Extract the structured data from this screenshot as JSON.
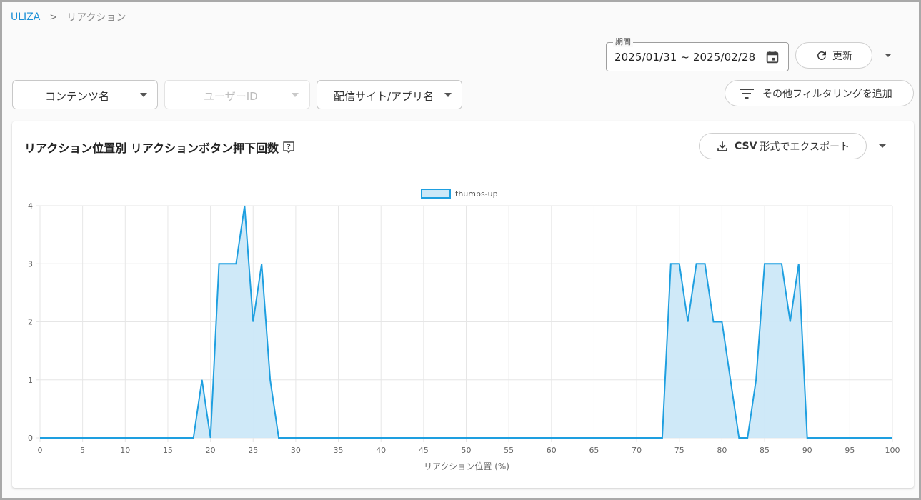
{
  "breadcrumb": {
    "root": "ULIZA",
    "current": "リアクション"
  },
  "period": {
    "legend": "期間",
    "value": "2025/01/31 ~ 2025/02/28"
  },
  "toolbar": {
    "refresh_label": "更新"
  },
  "filters": {
    "content_name": "コンテンツ名",
    "user_id": "ユーザーID",
    "site_app": "配信サイト/アプリ名",
    "more_filters": "その他フィルタリングを追加"
  },
  "card": {
    "title": "リアクション位置別 リアクションボタン押下回数",
    "export_prefix": "CSV",
    "export_suffix": "形式でエクスポート"
  },
  "colors": {
    "accent": "#1a8fd6",
    "series_line": "#1e9fe0",
    "series_fill": "#cce8f8"
  },
  "icons": [
    "calendar-icon",
    "refresh-icon",
    "chevron-down-icon",
    "filter-icon",
    "help-icon",
    "download-icon"
  ],
  "chart_data": {
    "type": "area",
    "xlabel": "リアクション位置 (%)",
    "ylabel": "",
    "xlim": [
      0,
      100
    ],
    "ylim": [
      0,
      4
    ],
    "x_ticks": [
      0,
      5,
      10,
      15,
      20,
      25,
      30,
      35,
      40,
      45,
      50,
      55,
      60,
      65,
      70,
      75,
      80,
      85,
      90,
      95,
      100
    ],
    "y_ticks": [
      0,
      1,
      2,
      3,
      4
    ],
    "grid": true,
    "legend": "top-center",
    "series": [
      {
        "name": "thumbs-up",
        "x": [
          0,
          1,
          2,
          3,
          4,
          5,
          6,
          7,
          8,
          9,
          10,
          11,
          12,
          13,
          14,
          15,
          16,
          17,
          18,
          19,
          20,
          21,
          22,
          23,
          24,
          25,
          26,
          27,
          28,
          29,
          30,
          31,
          32,
          33,
          34,
          35,
          36,
          37,
          38,
          39,
          40,
          41,
          42,
          43,
          44,
          45,
          46,
          47,
          48,
          49,
          50,
          51,
          52,
          53,
          54,
          55,
          56,
          57,
          58,
          59,
          60,
          61,
          62,
          63,
          64,
          65,
          66,
          67,
          68,
          69,
          70,
          71,
          72,
          73,
          74,
          75,
          76,
          77,
          78,
          79,
          80,
          81,
          82,
          83,
          84,
          85,
          86,
          87,
          88,
          89,
          90,
          91,
          92,
          93,
          94,
          95,
          96,
          97,
          98,
          99,
          100
        ],
        "values": [
          0,
          0,
          0,
          0,
          0,
          0,
          0,
          0,
          0,
          0,
          0,
          0,
          0,
          0,
          0,
          0,
          0,
          0,
          0,
          1,
          0,
          3,
          3,
          3,
          4,
          2,
          3,
          1,
          0,
          0,
          0,
          0,
          0,
          0,
          0,
          0,
          0,
          0,
          0,
          0,
          0,
          0,
          0,
          0,
          0,
          0,
          0,
          0,
          0,
          0,
          0,
          0,
          0,
          0,
          0,
          0,
          0,
          0,
          0,
          0,
          0,
          0,
          0,
          0,
          0,
          0,
          0,
          0,
          0,
          0,
          0,
          0,
          0,
          0,
          3,
          3,
          2,
          3,
          3,
          2,
          2,
          1,
          0,
          0,
          1,
          3,
          3,
          3,
          2,
          3,
          0,
          0,
          0,
          0,
          0,
          0,
          0,
          0,
          0,
          0,
          0
        ]
      }
    ]
  }
}
